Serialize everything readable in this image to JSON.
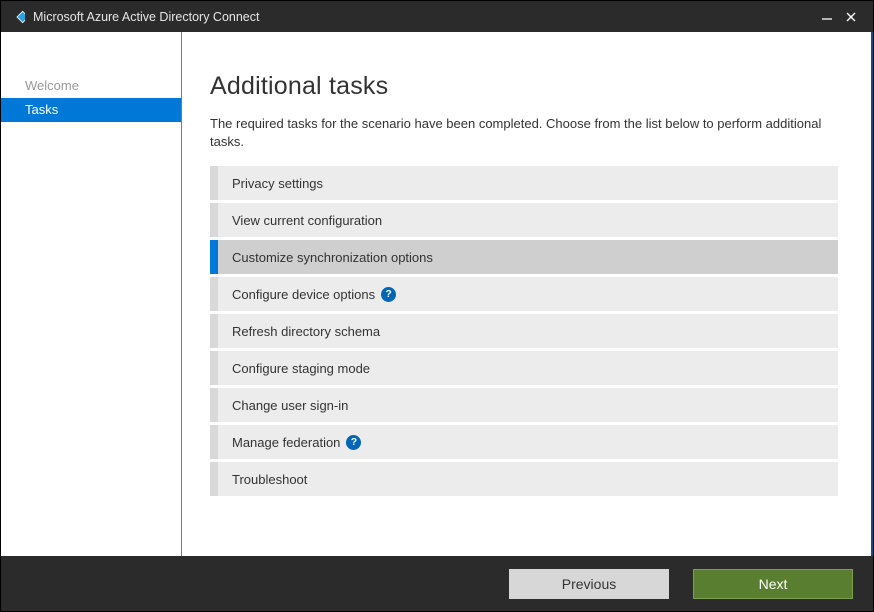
{
  "window": {
    "title": "Microsoft Azure Active Directory Connect"
  },
  "sidebar": {
    "items": [
      {
        "label": "Welcome",
        "state": "disabled"
      },
      {
        "label": "Tasks",
        "state": "active"
      }
    ]
  },
  "main": {
    "heading": "Additional tasks",
    "description": "The required tasks for the scenario have been completed. Choose from the list below to perform additional tasks.",
    "tasks": [
      {
        "label": "Privacy settings",
        "selected": false,
        "help": false
      },
      {
        "label": "View current configuration",
        "selected": false,
        "help": false
      },
      {
        "label": "Customize synchronization options",
        "selected": true,
        "help": false
      },
      {
        "label": "Configure device options",
        "selected": false,
        "help": true
      },
      {
        "label": "Refresh directory schema",
        "selected": false,
        "help": false
      },
      {
        "label": "Configure staging mode",
        "selected": false,
        "help": false
      },
      {
        "label": "Change user sign-in",
        "selected": false,
        "help": false
      },
      {
        "label": "Manage federation",
        "selected": false,
        "help": true
      },
      {
        "label": "Troubleshoot",
        "selected": false,
        "help": false
      }
    ]
  },
  "footer": {
    "previous_label": "Previous",
    "next_label": "Next"
  },
  "colors": {
    "accent": "#0078d7",
    "next_button": "#5a7e2f",
    "titlebar": "#2b2b2b"
  }
}
